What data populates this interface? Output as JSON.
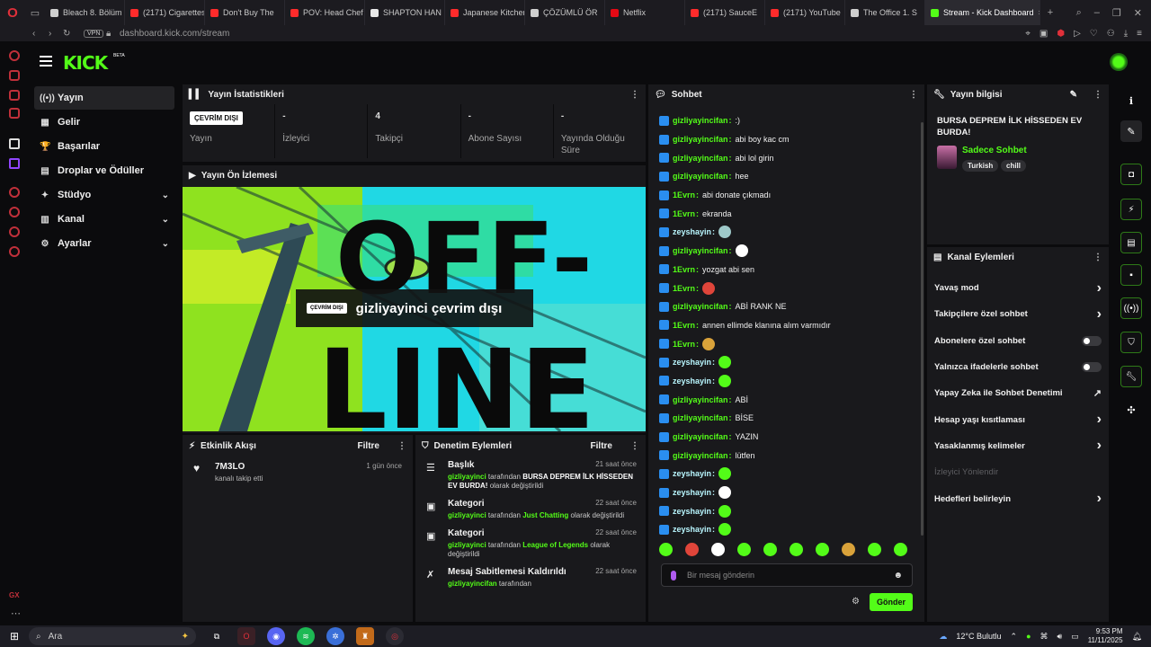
{
  "browser": {
    "tabs": [
      {
        "label": "Bleach 8. Bölüm",
        "color": "#cfcfcf"
      },
      {
        "label": "(2171) Cigarettes",
        "color": "#ff2b2b"
      },
      {
        "label": "Don't Buy The",
        "color": "#ff2b2b"
      },
      {
        "label": "POV: Head Chef",
        "color": "#ff2b2b"
      },
      {
        "label": "SHAPTON HAN",
        "color": "#e8e8e8"
      },
      {
        "label": "Japanese Kitchen",
        "color": "#ff2b2b"
      },
      {
        "label": "ÇÖZÜMLÜ ÖR",
        "color": "#cfcfcf"
      },
      {
        "label": "Netflix",
        "color": "#e50914"
      },
      {
        "label": "(2171) SauceE",
        "color": "#ff2b2b"
      },
      {
        "label": "(2171) YouTube",
        "color": "#ff2b2b"
      },
      {
        "label": "The Office 1. S",
        "color": "#cfcfcf"
      }
    ],
    "active_tab": "Stream - Kick Dashboard",
    "vpn_label": "VPN",
    "url": "dashboard.kick.com/stream"
  },
  "header": {
    "logo": "KICK",
    "beta": "BETA"
  },
  "nav": {
    "items": [
      {
        "label": "Yayın",
        "icon": "((•))",
        "chevron": ""
      },
      {
        "label": "Gelir",
        "icon": "▦",
        "chevron": ""
      },
      {
        "label": "Başarılar",
        "icon": "🏆",
        "chevron": ""
      },
      {
        "label": "Droplar ve Ödüller",
        "icon": "▤",
        "chevron": ""
      },
      {
        "label": "Stüdyo",
        "icon": "✦",
        "chevron": "⌄"
      },
      {
        "label": "Kanal",
        "icon": "▥",
        "chevron": "⌄"
      },
      {
        "label": "Ayarlar",
        "icon": "⚙",
        "chevron": "⌄"
      }
    ]
  },
  "stats": {
    "title": "Yayın İstatistikleri",
    "items": [
      {
        "value": "ÇEVRİM DIŞI",
        "label": "Yayın"
      },
      {
        "value": "-",
        "label": "İzleyici"
      },
      {
        "value": "4",
        "label": "Takipçi"
      },
      {
        "value": "-",
        "label": "Abone Sayısı"
      },
      {
        "value": "-",
        "label": "Yayında Olduğu Süre"
      }
    ]
  },
  "preview": {
    "title": "Yayın Ön İzlemesi",
    "offline_tag": "ÇEVRİM DIŞI",
    "offline_text": "gizliyayinci çevrim dışı",
    "art_text_top": "OFF-",
    "art_text_bottom": "LINE"
  },
  "activity": {
    "title": "Etkinlik Akışı",
    "filter": "Filtre",
    "events": [
      {
        "name": "7M3LO",
        "sub": "kanalı takip etti",
        "time": "1 gün önce"
      }
    ]
  },
  "moderation": {
    "title": "Denetim Eylemleri",
    "filter": "Filtre",
    "items": [
      {
        "title": "Başlık",
        "time": "21 saat önce",
        "user": "gizliyayinci",
        "by": "tarafından",
        "value": "BURSA DEPREM İLK HİSSEDEN EV BURDA!",
        "tail": "olarak değiştirildi"
      },
      {
        "title": "Kategori",
        "time": "22 saat önce",
        "user": "gizliyayinci",
        "by": "tarafından",
        "value": "Just Chatting",
        "tail": "olarak değiştirildi"
      },
      {
        "title": "Kategori",
        "time": "22 saat önce",
        "user": "gizliyayinci",
        "by": "tarafından",
        "value": "League of Legends",
        "tail": "olarak değiştirildi"
      },
      {
        "title": "Mesaj Sabitlemesi Kaldırıldı",
        "time": "22 saat önce",
        "user": "gizliyayincifan",
        "by": "tarafından",
        "value": "",
        "tail": ""
      }
    ]
  },
  "chat": {
    "title": "Sohbet",
    "messages": [
      {
        "user": "gizliyayincifan",
        "color": "#53fc18",
        "text": ":)",
        "emote": ""
      },
      {
        "user": "gizliyayincifan",
        "color": "#53fc18",
        "text": "abi boy kac cm",
        "emote": ""
      },
      {
        "user": "gizliyayincifan",
        "color": "#53fc18",
        "text": "abi lol girin",
        "emote": ""
      },
      {
        "user": "gizliyayincifan",
        "color": "#53fc18",
        "text": "hee",
        "emote": ""
      },
      {
        "user": "1Evrn",
        "color": "#53fc18",
        "text": "abi donate çıkmadı",
        "emote": ""
      },
      {
        "user": "1Evrn",
        "color": "#53fc18",
        "text": "ekranda",
        "emote": ""
      },
      {
        "user": "zeyshayin",
        "color": "#b9f7ff",
        "text": "",
        "emote": "#9ec9c9"
      },
      {
        "user": "gizliyayincifan",
        "color": "#53fc18",
        "text": "",
        "emote": "#ffffff"
      },
      {
        "user": "1Evrn",
        "color": "#53fc18",
        "text": "yozgat abi sen",
        "emote": ""
      },
      {
        "user": "1Evrn",
        "color": "#53fc18",
        "text": "",
        "emote": "#e0453a"
      },
      {
        "user": "gizliyayincifan",
        "color": "#53fc18",
        "text": "ABİ RANK NE",
        "emote": ""
      },
      {
        "user": "1Evrn",
        "color": "#53fc18",
        "text": "annen ellimde klanına alım varmıdır",
        "emote": ""
      },
      {
        "user": "1Evrn",
        "color": "#53fc18",
        "text": "",
        "emote": "#d9a23a"
      },
      {
        "user": "zeyshayin",
        "color": "#b9f7ff",
        "text": "",
        "emote": "#53fc18"
      },
      {
        "user": "zeyshayin",
        "color": "#b9f7ff",
        "text": "",
        "emote": "#53fc18"
      },
      {
        "user": "gizliyayincifan",
        "color": "#53fc18",
        "text": "ABİ",
        "emote": ""
      },
      {
        "user": "gizliyayincifan",
        "color": "#53fc18",
        "text": "BİSE",
        "emote": ""
      },
      {
        "user": "gizliyayincifan",
        "color": "#53fc18",
        "text": "YAZIN",
        "emote": ""
      },
      {
        "user": "gizliyayincifan",
        "color": "#53fc18",
        "text": "lütfen",
        "emote": ""
      },
      {
        "user": "zeyshayin",
        "color": "#b9f7ff",
        "text": "",
        "emote": "#53fc18"
      },
      {
        "user": "zeyshayin",
        "color": "#b9f7ff",
        "text": "",
        "emote": "#ffffff"
      },
      {
        "user": "zeyshayin",
        "color": "#b9f7ff",
        "text": "",
        "emote": "#53fc18"
      },
      {
        "user": "zeyshayin",
        "color": "#b9f7ff",
        "text": "",
        "emote": "#53fc18"
      }
    ],
    "emote_bar": [
      "#53fc18",
      "#e0453a",
      "#ffffff",
      "#53fc18",
      "#53fc18",
      "#53fc18",
      "#53fc18",
      "#d9a23a",
      "#53fc18",
      "#53fc18"
    ],
    "input_placeholder": "Bir mesaj gönderin",
    "send_label": "Gönder"
  },
  "stream_info": {
    "title": "Yayın bilgisi",
    "stream_title": "BURSA DEPREM İLK HİSSEDEN EV BURDA!",
    "category": "Sadece Sohbet",
    "tags": [
      "Turkish",
      "chill"
    ]
  },
  "channel_actions": {
    "title": "Kanal Eylemleri",
    "items": [
      {
        "label": "Yavaş mod",
        "kind": "chevron",
        "on": false
      },
      {
        "label": "Takipçilere özel sohbet",
        "kind": "chevron",
        "on": false
      },
      {
        "label": "Abonelere özel sohbet",
        "kind": "toggle",
        "on": false
      },
      {
        "label": "Yalnızca ifadelerle sohbet",
        "kind": "toggle",
        "on": false
      },
      {
        "label": "Yapay Zeka ile Sohbet Denetimi",
        "kind": "external",
        "on": false
      },
      {
        "label": "Hesap yaşı kısıtlaması",
        "kind": "chevron",
        "on": false
      },
      {
        "label": "Yasaklanmış kelimeler",
        "kind": "chevron",
        "on": false
      },
      {
        "label": "İzleyici Yönlendir",
        "kind": "disabled",
        "on": false
      },
      {
        "label": "Hedefleri belirleyin",
        "kind": "chevron",
        "on": false
      }
    ]
  },
  "taskbar": {
    "search_label": "Ara",
    "weather": "12°C Bulutlu",
    "time": "9:53 PM",
    "date": "11/11/2025"
  }
}
